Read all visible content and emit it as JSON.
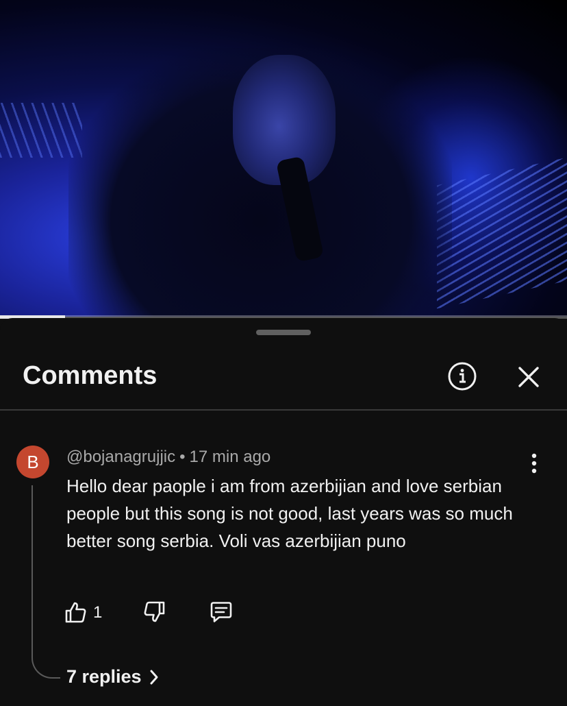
{
  "video": {
    "progress_fraction": 0.115
  },
  "comments_sheet": {
    "title": "Comments",
    "info_icon": "info-circle-icon",
    "close_icon": "close-icon"
  },
  "comment": {
    "avatar_letter": "B",
    "avatar_color": "#c4472f",
    "author": "@bojanagrujjic",
    "separator": "•",
    "time": "17 min ago",
    "text": "Hello dear paople i am from azerbijian and love serbian people but this song is not good, last years was so much better song serbia. Voli vas azerbijian puno",
    "like_count": "1",
    "replies_label": "7 replies",
    "icons": [
      "thumbs-up-icon",
      "thumbs-down-icon",
      "reply-comment-icon",
      "more-vertical-icon",
      "chevron-right-icon"
    ]
  }
}
